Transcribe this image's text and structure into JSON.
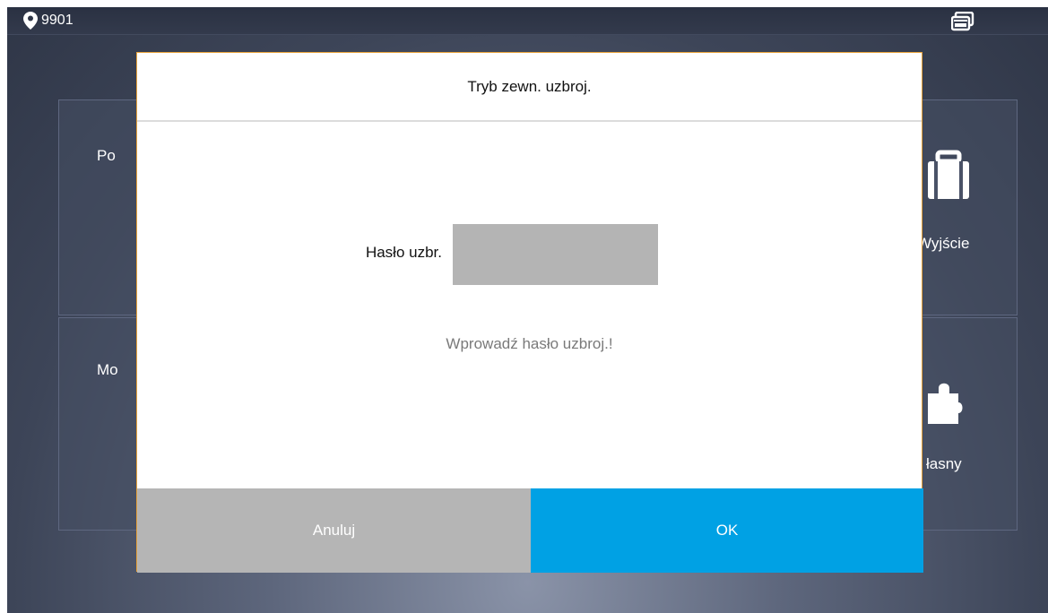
{
  "topbar": {
    "room_number": "9901",
    "location_icon": "location-pin-icon",
    "window_icon": "windows-icon"
  },
  "tiles": [
    {
      "label": "Po"
    },
    {
      "label": "Mo"
    },
    {
      "label": "Wyjście",
      "icon": "briefcase-icon"
    },
    {
      "label": "łasny",
      "icon": "puzzle-icon"
    }
  ],
  "dialog": {
    "title": "Tryb zewn. uzbroj.",
    "password_label": "Hasło uzbr.",
    "password_value": "",
    "hint": "Wprowadź hasło uzbroj.!",
    "cancel_label": "Anuluj",
    "ok_label": "OK"
  },
  "colors": {
    "ok_button": "#00a1e4",
    "cancel_button": "#b5b5b5",
    "dialog_border": "#e8a23a"
  }
}
